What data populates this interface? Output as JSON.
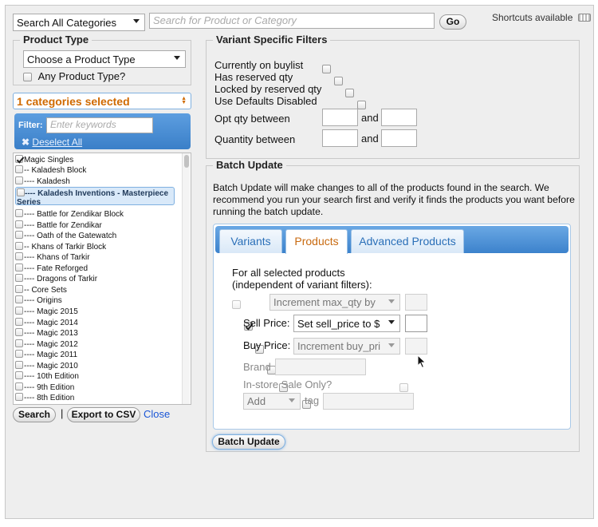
{
  "search": {
    "category_select": "Search All Categories",
    "query_placeholder": "Search for Product or Category",
    "go_label": "Go",
    "shortcuts_label": "Shortcuts available"
  },
  "product_type": {
    "legend": "Product Type",
    "select_value": "Choose a Product Type",
    "any_label": "Any Product Type?"
  },
  "categories": {
    "header": "1 categories selected",
    "filter_label": "Filter:",
    "filter_placeholder": "Enter keywords",
    "deselect_label": "Deselect All",
    "items": [
      {
        "label": "Magic Singles",
        "checked": true
      },
      {
        "label": "-- Kaladesh Block",
        "checked": false
      },
      {
        "label": "---- Kaladesh",
        "checked": false
      },
      {
        "label": "---- Kaladesh Inventions - Masterpiece Series",
        "checked": false
      },
      {
        "label": "---- Battle for Zendikar Block",
        "checked": false
      },
      {
        "label": "---- Battle for Zendikar",
        "checked": false
      },
      {
        "label": "---- Oath of the Gatewatch",
        "checked": false
      },
      {
        "label": "-- Khans of Tarkir Block",
        "checked": false
      },
      {
        "label": "---- Khans of Tarkir",
        "checked": false
      },
      {
        "label": "---- Fate Reforged",
        "checked": false
      },
      {
        "label": "---- Dragons of Tarkir",
        "checked": false
      },
      {
        "label": "-- Core Sets",
        "checked": false
      },
      {
        "label": "---- Origins",
        "checked": false
      },
      {
        "label": "---- Magic 2015",
        "checked": false
      },
      {
        "label": "---- Magic 2014",
        "checked": false
      },
      {
        "label": "---- Magic 2013",
        "checked": false
      },
      {
        "label": "---- Magic 2012",
        "checked": false
      },
      {
        "label": "---- Magic 2011",
        "checked": false
      },
      {
        "label": "---- Magic 2010",
        "checked": false
      },
      {
        "label": "---- 10th Edition",
        "checked": false
      },
      {
        "label": "---- 9th Edition",
        "checked": false
      },
      {
        "label": "---- 8th Edition",
        "checked": false
      }
    ]
  },
  "bottom_actions": {
    "search_label": "Search",
    "separator": "|",
    "export_label": "Export to CSV",
    "close_label": "Close"
  },
  "variant_filters": {
    "legend": "Variant Specific Filters",
    "checkboxes": [
      {
        "label": "Currently on buylist"
      },
      {
        "label": "Has reserved qty"
      },
      {
        "label": "Locked by reserved qty"
      },
      {
        "label": "Use Defaults Disabled"
      }
    ],
    "opt_qty_label": "Opt qty between",
    "quantity_label": "Quantity between",
    "and_label": "and"
  },
  "batch_update": {
    "legend": "Batch Update",
    "description": "Batch Update will make changes to all of the products found in the search. We recommend you run your search first and verify it finds the products you want before running the batch update.",
    "tabs": [
      "Variants",
      "Products",
      "Advanced Products"
    ],
    "intro_line1": "For all selected products",
    "intro_line2": "(independent of variant filters):",
    "max_qty_select": "Increment max_qty by",
    "sell_price_label": "Sell Price:",
    "sell_price_select": "Set sell_price to $",
    "buy_price_label": "Buy Price:",
    "buy_price_select": "Increment buy_pri",
    "brand_label": "Brand",
    "instore_label": "In-store Sale Only?",
    "tag_action": "Add",
    "tag_label": "tag",
    "button_label": "Batch Update"
  },
  "colors": {
    "accent_orange": "#d06a00",
    "tab_blue": "#3c82cc",
    "link_blue": "#1a56d6"
  }
}
